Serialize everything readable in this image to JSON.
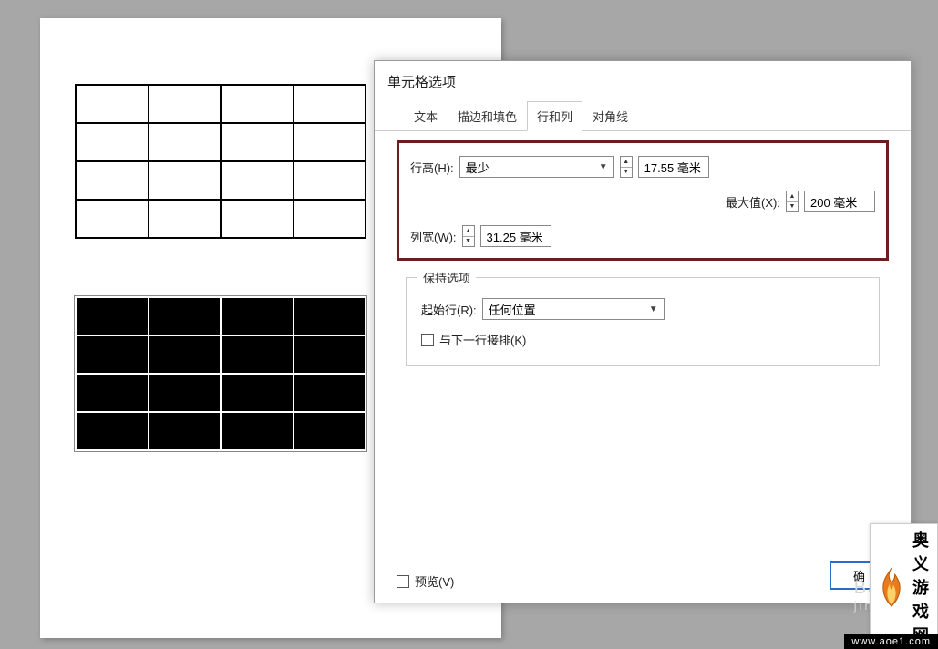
{
  "dialog": {
    "title": "单元格选项",
    "tabs": {
      "text": "文本",
      "stroke_fill": "描边和填色",
      "rows_cols": "行和列",
      "diagonal": "对角线"
    },
    "row_height_label": "行高(H):",
    "row_height_mode": "最少",
    "row_height_value": "17.55 毫米",
    "max_label": "最大值(X):",
    "max_value": "200 毫米",
    "col_width_label": "列宽(W):",
    "col_width_value": "31.25 毫米",
    "keep_options_legend": "保持选项",
    "start_row_label": "起始行(R):",
    "start_row_value": "任何位置",
    "keep_with_next_label": "与下一行接排(K)",
    "preview_label": "预览(V)",
    "ok_partial": "确"
  },
  "watermark": {
    "faded_top": "Ba",
    "faded_bottom": "jing",
    "site_name": "奥义游戏网",
    "site_url": "www.aoe1.com"
  }
}
